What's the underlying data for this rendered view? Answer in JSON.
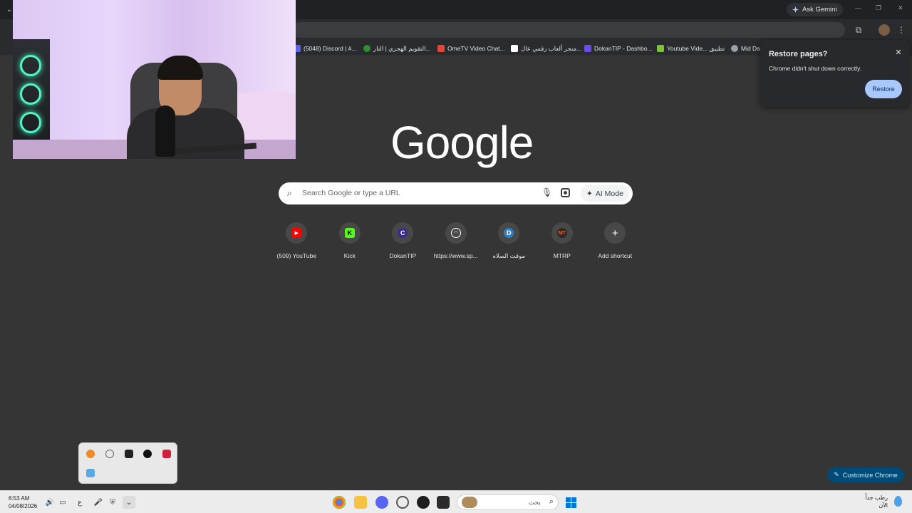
{
  "browser": {
    "ask_gemini": "Ask Gemini",
    "window_controls": {
      "minimize": "—",
      "restore": "❐",
      "close": "✕"
    }
  },
  "bookmarks": [
    {
      "label": "(5048) Discord | #...",
      "color": "#5865f2"
    },
    {
      "label": "التقويم الهجري | التار...",
      "color": "#2d8f2d"
    },
    {
      "label": "OmeTV Video Chat...",
      "color": "#e0463a"
    },
    {
      "label": "متجر ألعاب رقمي عال...",
      "color": "#ffffff"
    },
    {
      "label": "DokanTIP - Dashbo...",
      "color": "#6b4de6"
    },
    {
      "label": "Youtube Vide... تطبيق",
      "color": "#7cc33b"
    },
    {
      "label": "Mid Da",
      "color": "#9aa0a6"
    }
  ],
  "ntp": {
    "logo": "Google",
    "search_placeholder": "Search Google or type a URL",
    "ai_mode_label": "AI Mode",
    "shortcuts": [
      {
        "label": "(509) YouTube",
        "icon": "youtube-icon",
        "color": "#ff0000",
        "glyph": "▶"
      },
      {
        "label": "Kick",
        "icon": "kick-icon",
        "color": "#53fc18",
        "glyph": "K"
      },
      {
        "label": "DokanTIP",
        "icon": "dokantip-icon",
        "color": "#3b2b8f",
        "glyph": "C"
      },
      {
        "label": "https://www.sp...",
        "icon": "speedtest-icon",
        "color": "#484848",
        "glyph": "◔"
      },
      {
        "label": "موقت الصلاه",
        "icon": "letter-d-icon",
        "color": "#2f7fc1",
        "glyph": "D"
      },
      {
        "label": "MTRP",
        "icon": "mtrp-icon",
        "color": "#2b2b2b",
        "glyph": "M"
      },
      {
        "label": "Add shortcut",
        "icon": "plus-icon",
        "color": "#484848",
        "glyph": "+"
      }
    ],
    "customize_label": "Customize Chrome"
  },
  "restore_popup": {
    "title": "Restore pages?",
    "message": "Chrome didn't shut down correctly.",
    "button": "Restore",
    "close": "✕"
  },
  "taskbar": {
    "time": "6:53 AM",
    "date": "04/08/2026",
    "input_lang": "ع",
    "search_placeholder": "بحث",
    "weather_line1": "رطب جداً",
    "weather_line2": "الآن"
  }
}
